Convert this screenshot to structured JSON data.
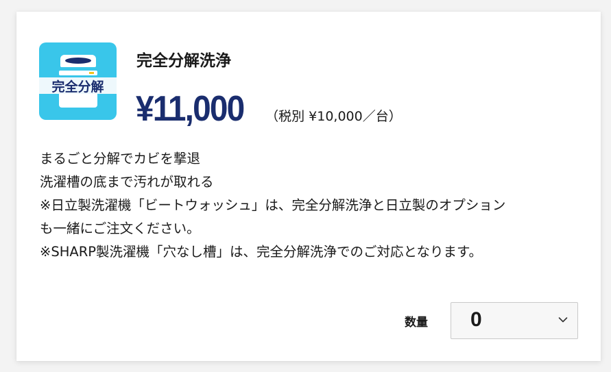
{
  "product": {
    "thumbnail_label": "完全分解",
    "title": "完全分解洗浄",
    "price": "¥11,000",
    "tax_note": "（税別 ¥10,000／台）",
    "description": [
      "まるごと分解でカビを撃退",
      "洗濯槽の底まで汚れが取れる",
      "※日立製洗濯機「ビートウォッシュ」は、完全分解洗浄と日立製のオプション",
      "も一緒にご注文ください。",
      "※SHARP製洗濯機「穴なし槽」は、完全分解洗浄でのご対応となります。"
    ]
  },
  "quantity": {
    "label": "数量",
    "selected": "0"
  },
  "colors": {
    "accent": "#1a2d6e",
    "thumbnail_bg": "#39c6ea"
  },
  "icons": {
    "thumbnail": "washing-machine-tub-icon",
    "dropdown": "chevron-down-icon"
  }
}
